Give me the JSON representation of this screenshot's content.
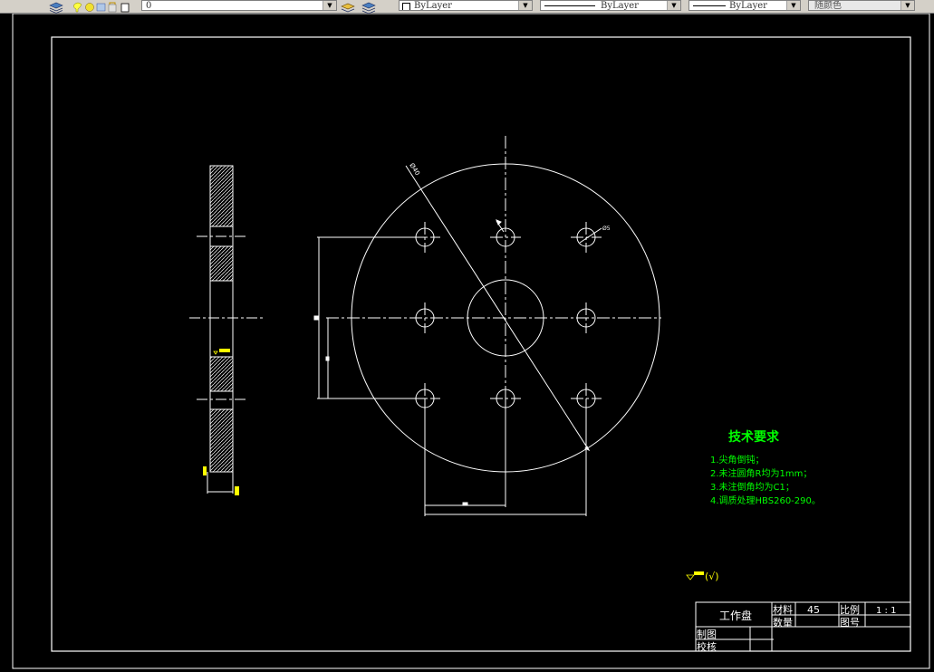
{
  "toolbar": {
    "layer_dropdown": {
      "value": "0"
    },
    "color_dropdown": {
      "value": "ByLayer"
    },
    "linetype_dropdown": {
      "value": "ByLayer"
    },
    "lineweight_dropdown": {
      "value": "ByLayer"
    },
    "plotstyle_dropdown": {
      "value": "随颜色"
    }
  },
  "drawing": {
    "colors": {
      "background": "#000000",
      "geometry": "#ffffff",
      "annotation": "#00ff00",
      "marker": "#ffff00"
    },
    "dim_diameter_label": "Ø40",
    "dim_hole_label": "Ø5",
    "technical_requirements": {
      "title": "技术要求",
      "items": [
        "1.尖角倒钝；",
        "2.未注圆角R均为1mm；",
        "3.未注倒角均为C1；",
        "4.调质处理HBS260-290。"
      ]
    },
    "surface_symbol_note": "(√)",
    "title_block": {
      "part_name": "工作盘",
      "material_label": "材料",
      "material_value": "45",
      "scale_label": "比例",
      "scale_value": "1 : 1",
      "quantity_label": "数量",
      "drawing_no_label": "图号",
      "drawn_by_label": "制图",
      "checked_by_label": "校核"
    }
  }
}
